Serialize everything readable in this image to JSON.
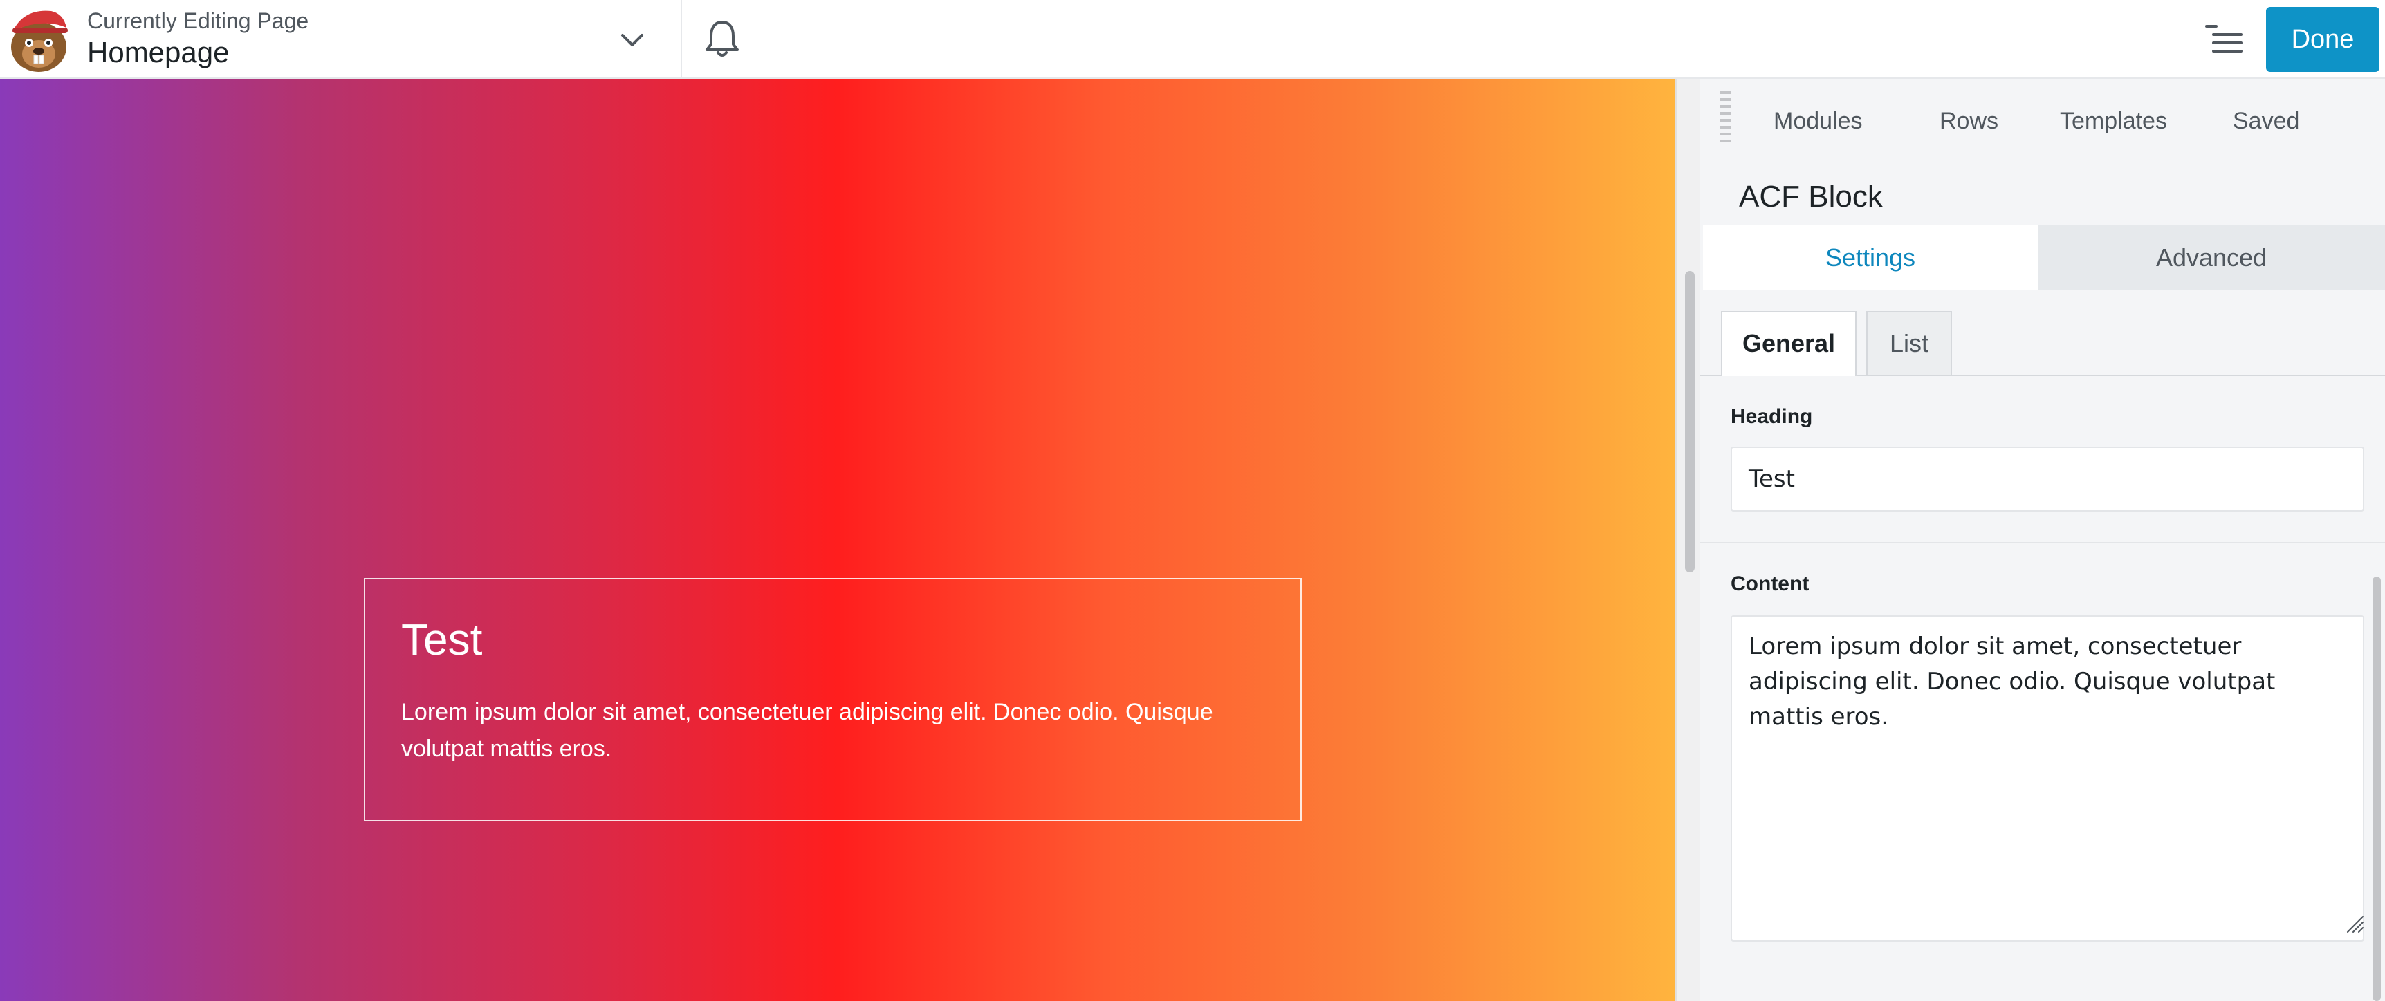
{
  "header": {
    "context_label": "Currently Editing Page",
    "page_title": "Homepage",
    "done_label": "Done"
  },
  "canvas": {
    "module_heading": "Test",
    "module_text": "Lorem ipsum dolor sit amet, consectetuer adipiscing elit. Donec odio. Quisque volutpat mattis eros."
  },
  "panel": {
    "tabs": [
      "Modules",
      "Rows",
      "Templates",
      "Saved"
    ],
    "block_title": "ACF Block",
    "segments": {
      "settings": "Settings",
      "advanced": "Advanced"
    },
    "subtabs": {
      "general": "General",
      "list": "List"
    },
    "fields": {
      "heading": {
        "label": "Heading",
        "value": "Test"
      },
      "content": {
        "label": "Content",
        "value": "Lorem ipsum dolor sit amet, consectetuer adipiscing elit. Donec odio. Quisque volutpat mattis eros."
      }
    }
  },
  "colors": {
    "accent": "#0e93c7",
    "gradient": [
      "#8a3ab9",
      "#ff1e1e",
      "#ffb43e"
    ]
  },
  "icons": [
    "beaver-logo-icon",
    "chevron-down-icon",
    "bell-icon",
    "outline-list-icon",
    "resize-handle-icon"
  ]
}
